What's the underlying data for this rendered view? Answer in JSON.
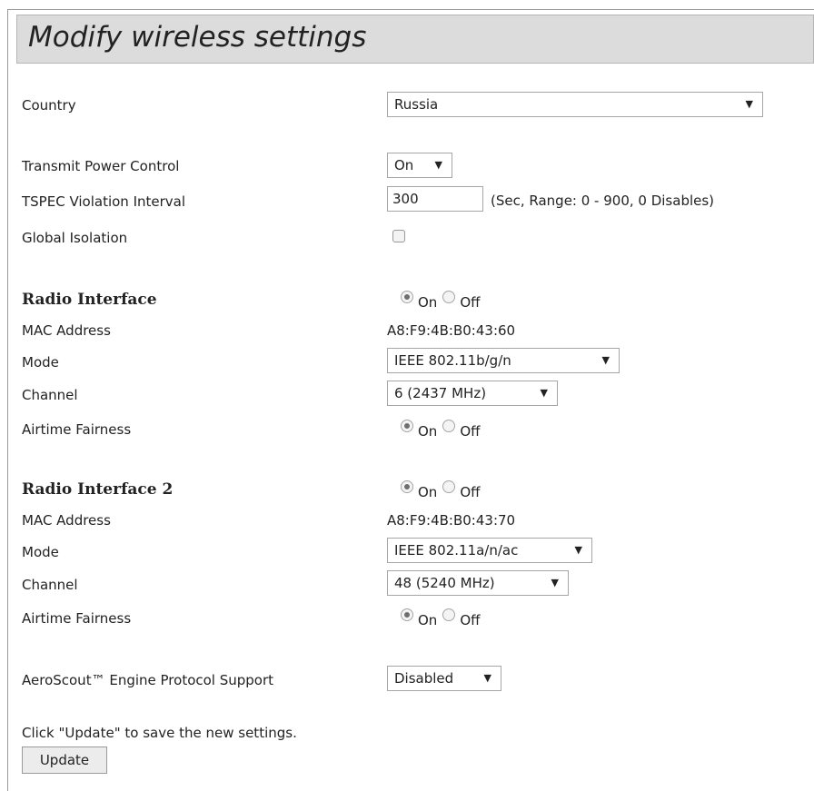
{
  "title": "Modify wireless settings",
  "country": {
    "label": "Country",
    "value": "Russia"
  },
  "tpc": {
    "label": "Transmit Power Control",
    "value": "On"
  },
  "tspec": {
    "label": "TSPEC Violation Interval",
    "value": "300",
    "note": "(Sec, Range: 0 - 900, 0 Disables)"
  },
  "isolation": {
    "label": "Global Isolation",
    "checked": false
  },
  "radio1": {
    "heading": "Radio Interface",
    "on_label": "On",
    "off_label": "Off",
    "mac_label": "MAC Address",
    "mac_value": "A8:F9:4B:B0:43:60",
    "mode_label": "Mode",
    "mode_value": "IEEE 802.11b/g/n",
    "channel_label": "Channel",
    "channel_value": "6 (2437 MHz)",
    "airtime_label": "Airtime Fairness",
    "airtime_on": "On",
    "airtime_off": "Off"
  },
  "radio2": {
    "heading": "Radio Interface 2",
    "on_label": "On",
    "off_label": "Off",
    "mac_label": "MAC Address",
    "mac_value": "A8:F9:4B:B0:43:70",
    "mode_label": "Mode",
    "mode_value": "IEEE 802.11a/n/ac",
    "channel_label": "Channel",
    "channel_value": "48 (5240 MHz)",
    "airtime_label": "Airtime Fairness",
    "airtime_on": "On",
    "airtime_off": "Off"
  },
  "aeroscout": {
    "label": "AeroScout™ Engine Protocol Support",
    "value": "Disabled"
  },
  "footer": {
    "hint": "Click \"Update\" to save the new settings.",
    "button": "Update"
  }
}
